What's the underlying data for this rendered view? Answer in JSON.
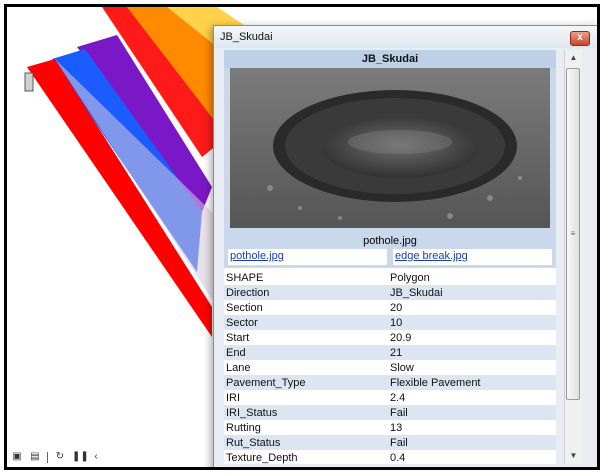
{
  "window": {
    "title": "JB_Skudai",
    "close_glyph": "x"
  },
  "popup": {
    "header": "JB_Skudai",
    "photo_caption": "pothole.jpg",
    "attachments": [
      "pothole.jpg",
      "edge break.jpg"
    ],
    "attributes": [
      {
        "field": "SHAPE",
        "value": "Polygon"
      },
      {
        "field": "Direction",
        "value": "JB_Skudai"
      },
      {
        "field": "Section",
        "value": "20"
      },
      {
        "field": "Sector",
        "value": "10"
      },
      {
        "field": "Start",
        "value": "20.9"
      },
      {
        "field": "End",
        "value": "21"
      },
      {
        "field": "Lane",
        "value": "Slow"
      },
      {
        "field": "Pavement_Type",
        "value": "Flexible Pavement"
      },
      {
        "field": "IRI",
        "value": "2.4"
      },
      {
        "field": "IRI_Status",
        "value": "Fail"
      },
      {
        "field": "Rutting",
        "value": "13"
      },
      {
        "field": "Rut_Status",
        "value": "Fail"
      },
      {
        "field": "Texture_Depth",
        "value": "0.4"
      }
    ]
  },
  "map": {
    "band_colors": [
      "#ff0000",
      "#0060ff",
      "#8800cc",
      "#ff7a00",
      "#ffd000"
    ]
  },
  "icons": {
    "scroll_up": "up-arrow-icon",
    "scroll_down": "down-arrow-icon",
    "scroll_grip": "grip-icon"
  }
}
